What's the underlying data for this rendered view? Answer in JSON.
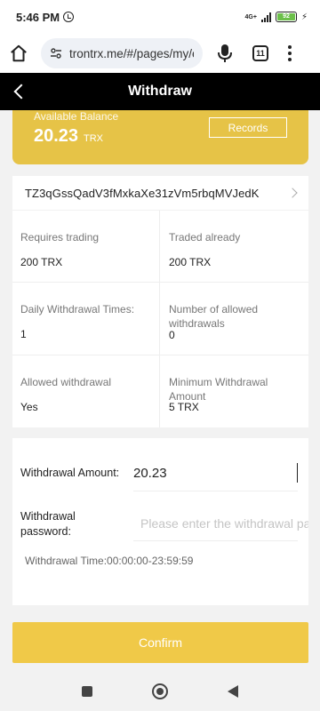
{
  "status_bar": {
    "time": "5:46 PM",
    "network": "4G+",
    "battery": "92"
  },
  "browser": {
    "url": "trontrx.me/#/pages/my/e",
    "tab_count": "11"
  },
  "header": {
    "title": "Withdraw"
  },
  "balance": {
    "label": "Available Balance",
    "amount": "20.23",
    "unit": "TRX",
    "records_label": "Records"
  },
  "address": "TZ3qGssQadV3fMxkaXe31zVm5rbqMVJedK",
  "info": [
    {
      "label": "Requires trading",
      "value": "200 TRX"
    },
    {
      "label": "Traded already",
      "value": "200 TRX"
    },
    {
      "label": "Daily Withdrawal Times:",
      "value": "1"
    },
    {
      "label": "Number of allowed withdrawals",
      "value": "0"
    },
    {
      "label": "Allowed withdrawal",
      "value": "Yes"
    },
    {
      "label": "Minimum Withdrawal Amount",
      "value": "5 TRX"
    }
  ],
  "form": {
    "amount_label": "Withdrawal Amount:",
    "amount_value": "20.23",
    "password_label": "Withdrawal password:",
    "password_placeholder": "Please enter the withdrawal password",
    "time_text": "Withdrawal Time:00:00:00-23:59:59"
  },
  "confirm_label": "Confirm",
  "colors": {
    "accent": "#f0c948",
    "card": "#e6c347",
    "header": "#000000"
  }
}
